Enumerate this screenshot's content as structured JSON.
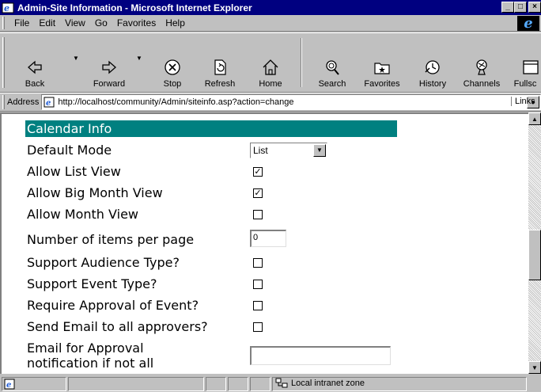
{
  "window": {
    "title": "Admin-Site Information - Microsoft Internet Explorer"
  },
  "menu": [
    "File",
    "Edit",
    "View",
    "Go",
    "Favorites",
    "Help"
  ],
  "toolbar": {
    "back": "Back",
    "forward": "Forward",
    "stop": "Stop",
    "refresh": "Refresh",
    "home": "Home",
    "search": "Search",
    "favorites": "Favorites",
    "history": "History",
    "channels": "Channels",
    "fullscreen": "Fullsc"
  },
  "address": {
    "label": "Address",
    "url": "http://localhost/community/Admin/siteinfo.asp?action=change",
    "links": "Links"
  },
  "form": {
    "section_title": "Calendar Info",
    "default_mode": {
      "label": "Default Mode",
      "value": "List"
    },
    "allow_list_view": {
      "label": "Allow List View",
      "checked": true
    },
    "allow_big_month_view": {
      "label": "Allow Big Month View",
      "checked": true
    },
    "allow_month_view": {
      "label": "Allow Month View",
      "checked": false
    },
    "items_per_page": {
      "label": "Number of items per page",
      "value": "0"
    },
    "support_audience_type": {
      "label": "Support Audience Type?",
      "checked": false
    },
    "support_event_type": {
      "label": "Support Event Type?",
      "checked": false
    },
    "require_approval": {
      "label": "Require Approval of Event?",
      "checked": false
    },
    "send_email_all": {
      "label": "Send Email to all approvers?",
      "checked": false
    },
    "email_notification": {
      "label_line1": "Email for Approval",
      "label_line2": "notification if not all",
      "value": ""
    }
  },
  "status": {
    "zone": "Local intranet zone"
  },
  "colors": {
    "titlebar": "#000080",
    "section_header": "#008080",
    "chrome": "#c0c0c0"
  }
}
